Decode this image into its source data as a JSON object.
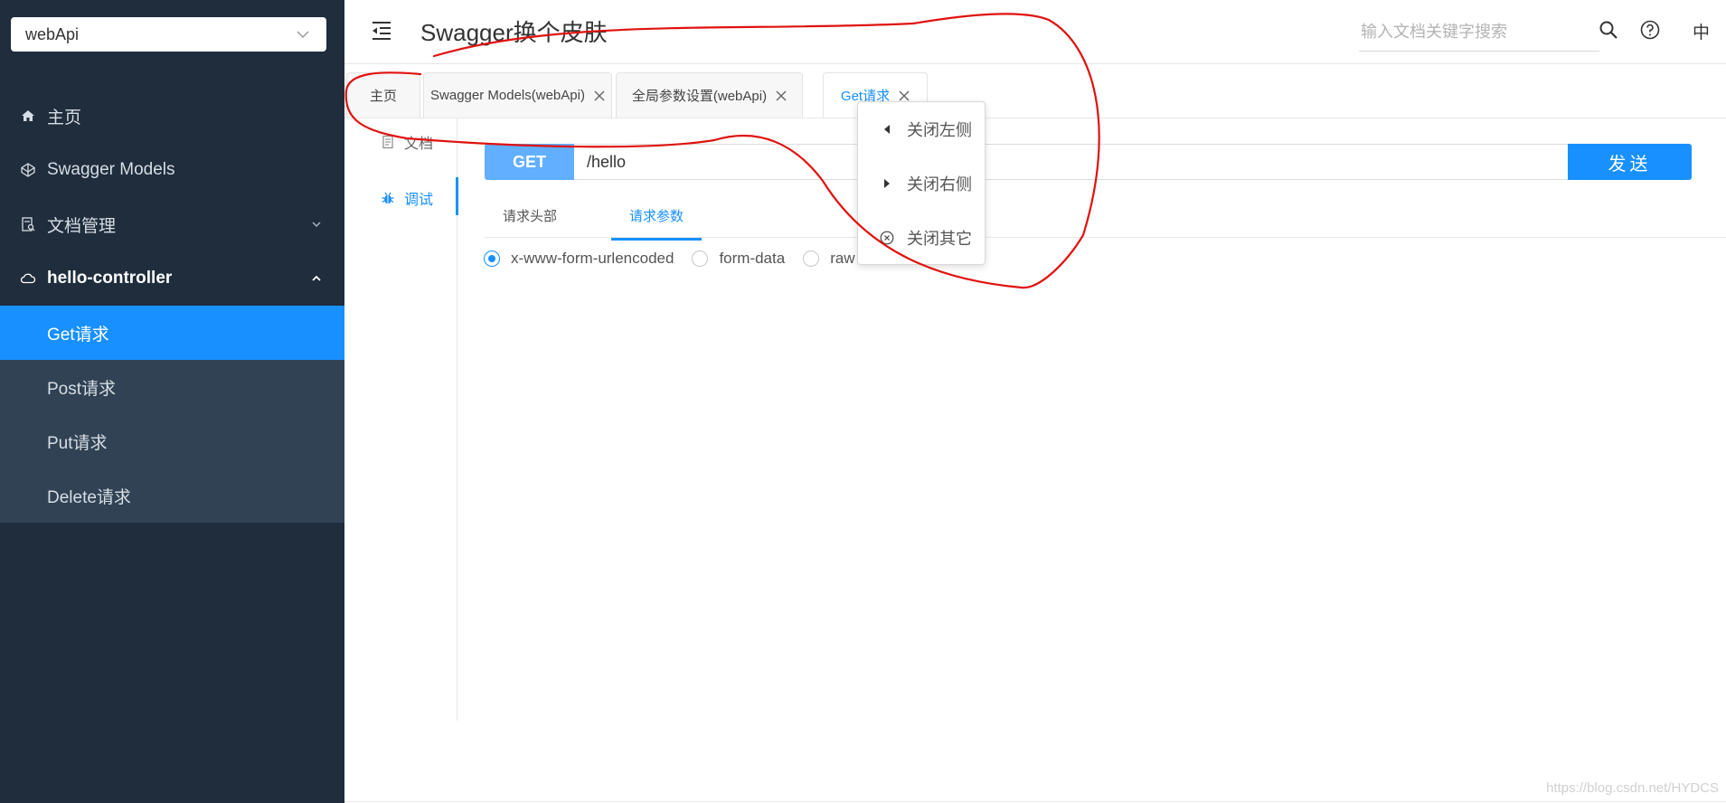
{
  "sidebar": {
    "project": "webApi",
    "menu": [
      {
        "label": "主页"
      },
      {
        "label": "Swagger Models"
      },
      {
        "label": "文档管理"
      },
      {
        "label": "hello-controller"
      }
    ],
    "submenu": [
      {
        "label": "Get请求"
      },
      {
        "label": "Post请求"
      },
      {
        "label": "Put请求"
      },
      {
        "label": "Delete请求"
      }
    ]
  },
  "header": {
    "title": "Swagger换个皮肤",
    "search_placeholder": "输入文档关键字搜索",
    "lang": "中"
  },
  "tabs": [
    {
      "label": "主页"
    },
    {
      "label": "Swagger Models(webApi)"
    },
    {
      "label": "全局参数设置(webApi)"
    },
    {
      "label": "Get请求"
    }
  ],
  "context_menu": {
    "items": [
      {
        "label": "关闭左侧",
        "icon": "caret-left-icon"
      },
      {
        "label": "关闭右侧",
        "icon": "caret-right-icon"
      },
      {
        "label": "关闭其它",
        "icon": "close-circle-icon"
      }
    ]
  },
  "mininav": {
    "items": [
      {
        "label": "文档"
      },
      {
        "label": "调试"
      }
    ]
  },
  "request": {
    "method": "GET",
    "url": "/hello",
    "send_label": "发送",
    "subtabs": [
      {
        "label": "请求头部"
      },
      {
        "label": "请求参数"
      }
    ],
    "body_types": [
      {
        "label": "x-www-form-urlencoded"
      },
      {
        "label": "form-data"
      },
      {
        "label": "raw"
      }
    ]
  },
  "watermark": "https://blog.csdn.net/HYDCS",
  "colors": {
    "sidebar_bg": "#1f2d3d",
    "submenu_bg": "#304254",
    "accent": "#1890ff",
    "get_method": "#61affe",
    "annotation": "#e0120f"
  }
}
